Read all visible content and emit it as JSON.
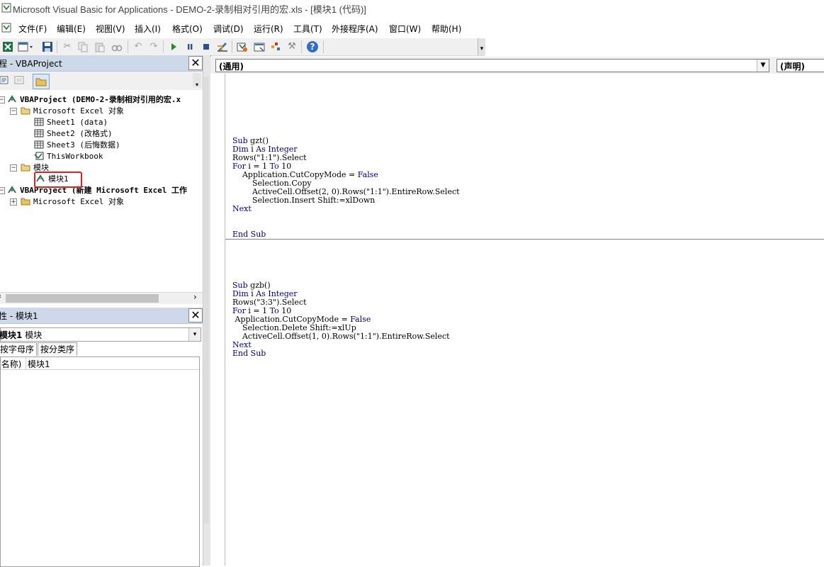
{
  "window": {
    "title": "Microsoft Visual Basic for Applications - DEMO-2-录制相对引用的宏.xls - [模块1 (代码)]"
  },
  "menu": [
    "文件(F)",
    "编辑(E)",
    "视图(V)",
    "插入(I)",
    "格式(O)",
    "调试(D)",
    "运行(R)",
    "工具(T)",
    "外接程序(A)",
    "窗口(W)",
    "帮助(H)"
  ],
  "toolbar": {
    "icons": [
      "excel-icon",
      "insert-module-icon",
      "save-icon",
      "cut-icon",
      "copy-icon",
      "paste-icon",
      "find-icon",
      "undo-icon",
      "redo-icon",
      "run-icon",
      "break-icon",
      "reset-icon",
      "design-mode-icon",
      "project-explorer-icon",
      "properties-icon",
      "object-browser-icon",
      "toolbox-icon",
      "help-icon"
    ]
  },
  "project_panel": {
    "title": "程 - VBAProject",
    "tree": [
      {
        "label": "VBAProject (DEMO-2-录制相对引用的宏.x",
        "level": 0,
        "bold": true,
        "expanded": true
      },
      {
        "label": "Microsoft Excel 对象",
        "level": 1,
        "bold": false,
        "expanded": true
      },
      {
        "label": "Sheet1 (data)",
        "level": 2,
        "bold": false
      },
      {
        "label": "Sheet2 (改格式)",
        "level": 2,
        "bold": false
      },
      {
        "label": "Sheet3 (后悔数据)",
        "level": 2,
        "bold": false
      },
      {
        "label": "ThisWorkbook",
        "level": 2,
        "bold": false
      },
      {
        "label": "模块",
        "level": 1,
        "bold": false,
        "expanded": true
      },
      {
        "label": "模块1",
        "level": 2,
        "bold": false,
        "highlighted": true
      },
      {
        "label": "VBAProject (新建 Microsoft Excel 工作",
        "level": 0,
        "bold": true,
        "expanded": true
      },
      {
        "label": "Microsoft Excel 对象",
        "level": 1,
        "bold": false,
        "expanded": false
      }
    ]
  },
  "properties_panel": {
    "title": "性 - 模块1",
    "object": "模块1",
    "object_type": "模块",
    "tabs": [
      "按字母序",
      "按分类序"
    ],
    "rows": [
      {
        "key": "(名称)",
        "value": "模块1"
      }
    ]
  },
  "code_window": {
    "object_combo": "(通用)",
    "proc_combo": "(声明)",
    "procedures": [
      {
        "lines": [
          "Sub gzt()",
          "Dim i As Integer",
          "Rows(\"1:1\").Select",
          "For i = 1 To 10",
          "    Application.CutCopyMode = False",
          "        Selection.Copy",
          "        ActiveCell.Offset(2, 0).Rows(\"1:1\").EntireRow.Select",
          "        Selection.Insert Shift:=xlDown",
          "Next",
          "",
          "",
          "End Sub"
        ]
      },
      {
        "lines": [
          "Sub gzb()",
          "Dim i As Integer",
          "Rows(\"3:3\").Select",
          "For i = 1 To 10",
          " Application.CutCopyMode = False",
          "    Selection.Delete Shift:=xlUp",
          "    ActiveCell.Offset(1, 0).Rows(\"1:1\").EntireRow.Select",
          "Next",
          "End Sub"
        ]
      }
    ]
  },
  "colors": {
    "panel_title_bg": "#cdd9e8",
    "highlight_border": "#e02020",
    "keyword": "#000080"
  }
}
